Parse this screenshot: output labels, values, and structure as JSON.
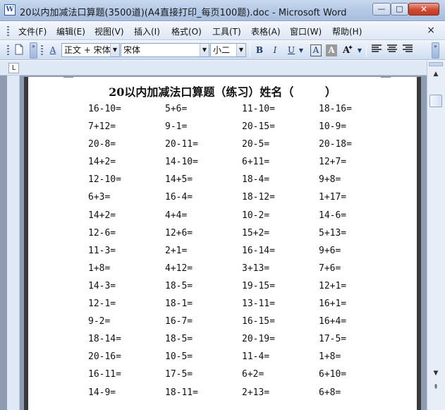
{
  "window": {
    "title": "20以内加减法口算题(3500道)(A4直接打印_每页100题).doc - Microsoft Word",
    "min_glyph": "—",
    "max_glyph": "□",
    "close_glyph": "✕"
  },
  "menu": {
    "items": [
      "文件(F)",
      "编辑(E)",
      "视图(V)",
      "插入(I)",
      "格式(O)",
      "工具(T)",
      "表格(A)",
      "窗口(W)",
      "帮助(H)"
    ],
    "close_doc": "×"
  },
  "toolbar": {
    "style_value": "正文 + 宋体",
    "font_value": "宋体",
    "size_value": "小二",
    "bold_label": "B",
    "italic_label": "I",
    "underline_label": "U",
    "char_border_label": "A",
    "char_shading_label": "A",
    "style_pane_label": "A",
    "chevron_label": "»"
  },
  "ruler": {
    "tab_selector": "L"
  },
  "document": {
    "title": "20以内加减法口算题（练习）姓名（        ）",
    "rows": [
      [
        "16-10=",
        "5+6=",
        "11-10=",
        "18-16="
      ],
      [
        "7+12=",
        "9-1=",
        "20-15=",
        "10-9="
      ],
      [
        "20-8=",
        "20-11=",
        "20-5=",
        "20-18="
      ],
      [
        "14+2=",
        "14-10=",
        "6+11=",
        "12+7="
      ],
      [
        "12-10=",
        "14+5=",
        "18-4=",
        "9+8="
      ],
      [
        "6+3=",
        "16-4=",
        "18-12=",
        "1+17="
      ],
      [
        "14+2=",
        "4+4=",
        "10-2=",
        "14-6="
      ],
      [
        "12-6=",
        "12+6=",
        "15+2=",
        "5+13="
      ],
      [
        "11-3=",
        "2+1=",
        "16-14=",
        "9+6="
      ],
      [
        "1+8=",
        "4+12=",
        "3+13=",
        "7+6="
      ],
      [
        "14-3=",
        "18-5=",
        "19-15=",
        "12+1="
      ],
      [
        "12-1=",
        "18-1=",
        "13-11=",
        "16+1="
      ],
      [
        "9-2=",
        "16-7=",
        "16-15=",
        "16+4="
      ],
      [
        "18-14=",
        "18-5=",
        "20-19=",
        "17-5="
      ],
      [
        "20-16=",
        "10-5=",
        "11-4=",
        "1+8="
      ],
      [
        "16-11=",
        "17-5=",
        "6+2=",
        "6+10="
      ],
      [
        "14-9=",
        "18-11=",
        "2+13=",
        "6+8="
      ]
    ]
  },
  "scrollbar": {
    "up": "▲",
    "down": "▼",
    "prev_page": "⇞"
  }
}
